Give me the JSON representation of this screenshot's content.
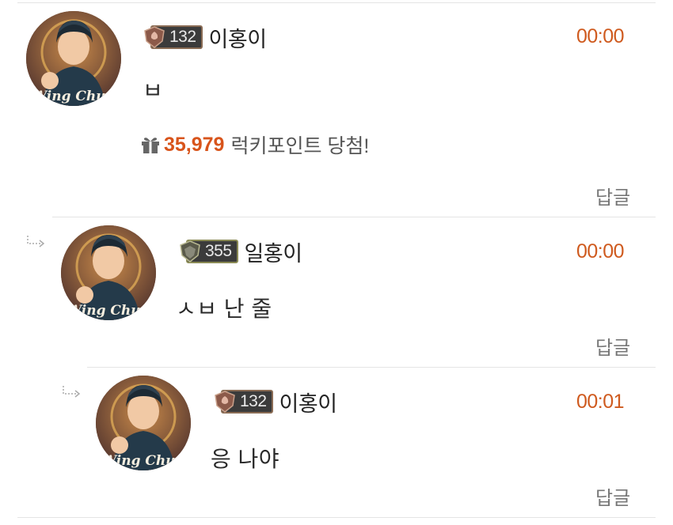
{
  "comments": [
    {
      "level": "132",
      "nickname": "이홍이",
      "time": "00:00",
      "text": "ㅂ",
      "lucky": {
        "points": "35,979",
        "label": "럭키포인트 당첨!"
      },
      "reply_label": "답글"
    },
    {
      "level": "355",
      "nickname": "일홍이",
      "time": "00:00",
      "text": "ㅅㅂ 난 줄",
      "reply_label": "답글"
    },
    {
      "level": "132",
      "nickname": "이홍이",
      "time": "00:01",
      "text": "응 나야",
      "reply_label": "답글"
    }
  ],
  "avatar_text": "Wing Chun",
  "colors": {
    "time": "#cf5a1e",
    "points": "#d8541b",
    "badge_bg": "#3b3b3b"
  },
  "icons": {
    "reply_arrow": "reply-arrow-icon",
    "gift": "gift-icon",
    "level_badge": "level-badge-icon"
  }
}
